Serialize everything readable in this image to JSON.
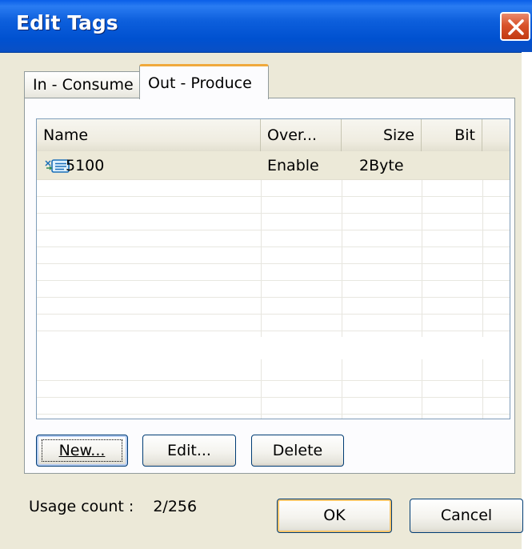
{
  "window": {
    "title": "Edit Tags"
  },
  "tabs": [
    {
      "label": "In - Consume",
      "active": false
    },
    {
      "label": "Out - Produce",
      "active": true
    }
  ],
  "table": {
    "columns": [
      "Name",
      "Over...",
      "Size",
      "Bit"
    ],
    "rows": [
      {
        "icon": "tag-icon",
        "name": "5100",
        "over": "Enable",
        "size": "2Byte",
        "bit": ""
      }
    ]
  },
  "buttons": {
    "new_label": "New...",
    "edit_label": "Edit...",
    "delete_label": "Delete",
    "ok_label": "OK",
    "cancel_label": "Cancel"
  },
  "usage": {
    "label": "Usage count :",
    "value": "2/256"
  },
  "colors": {
    "titlebar": "#0054e3",
    "close_button": "#d9532b",
    "dialog_background": "#ece9d8",
    "active_tab_highlight": "#f0a93c",
    "default_button_highlight": "#f6c56b"
  }
}
